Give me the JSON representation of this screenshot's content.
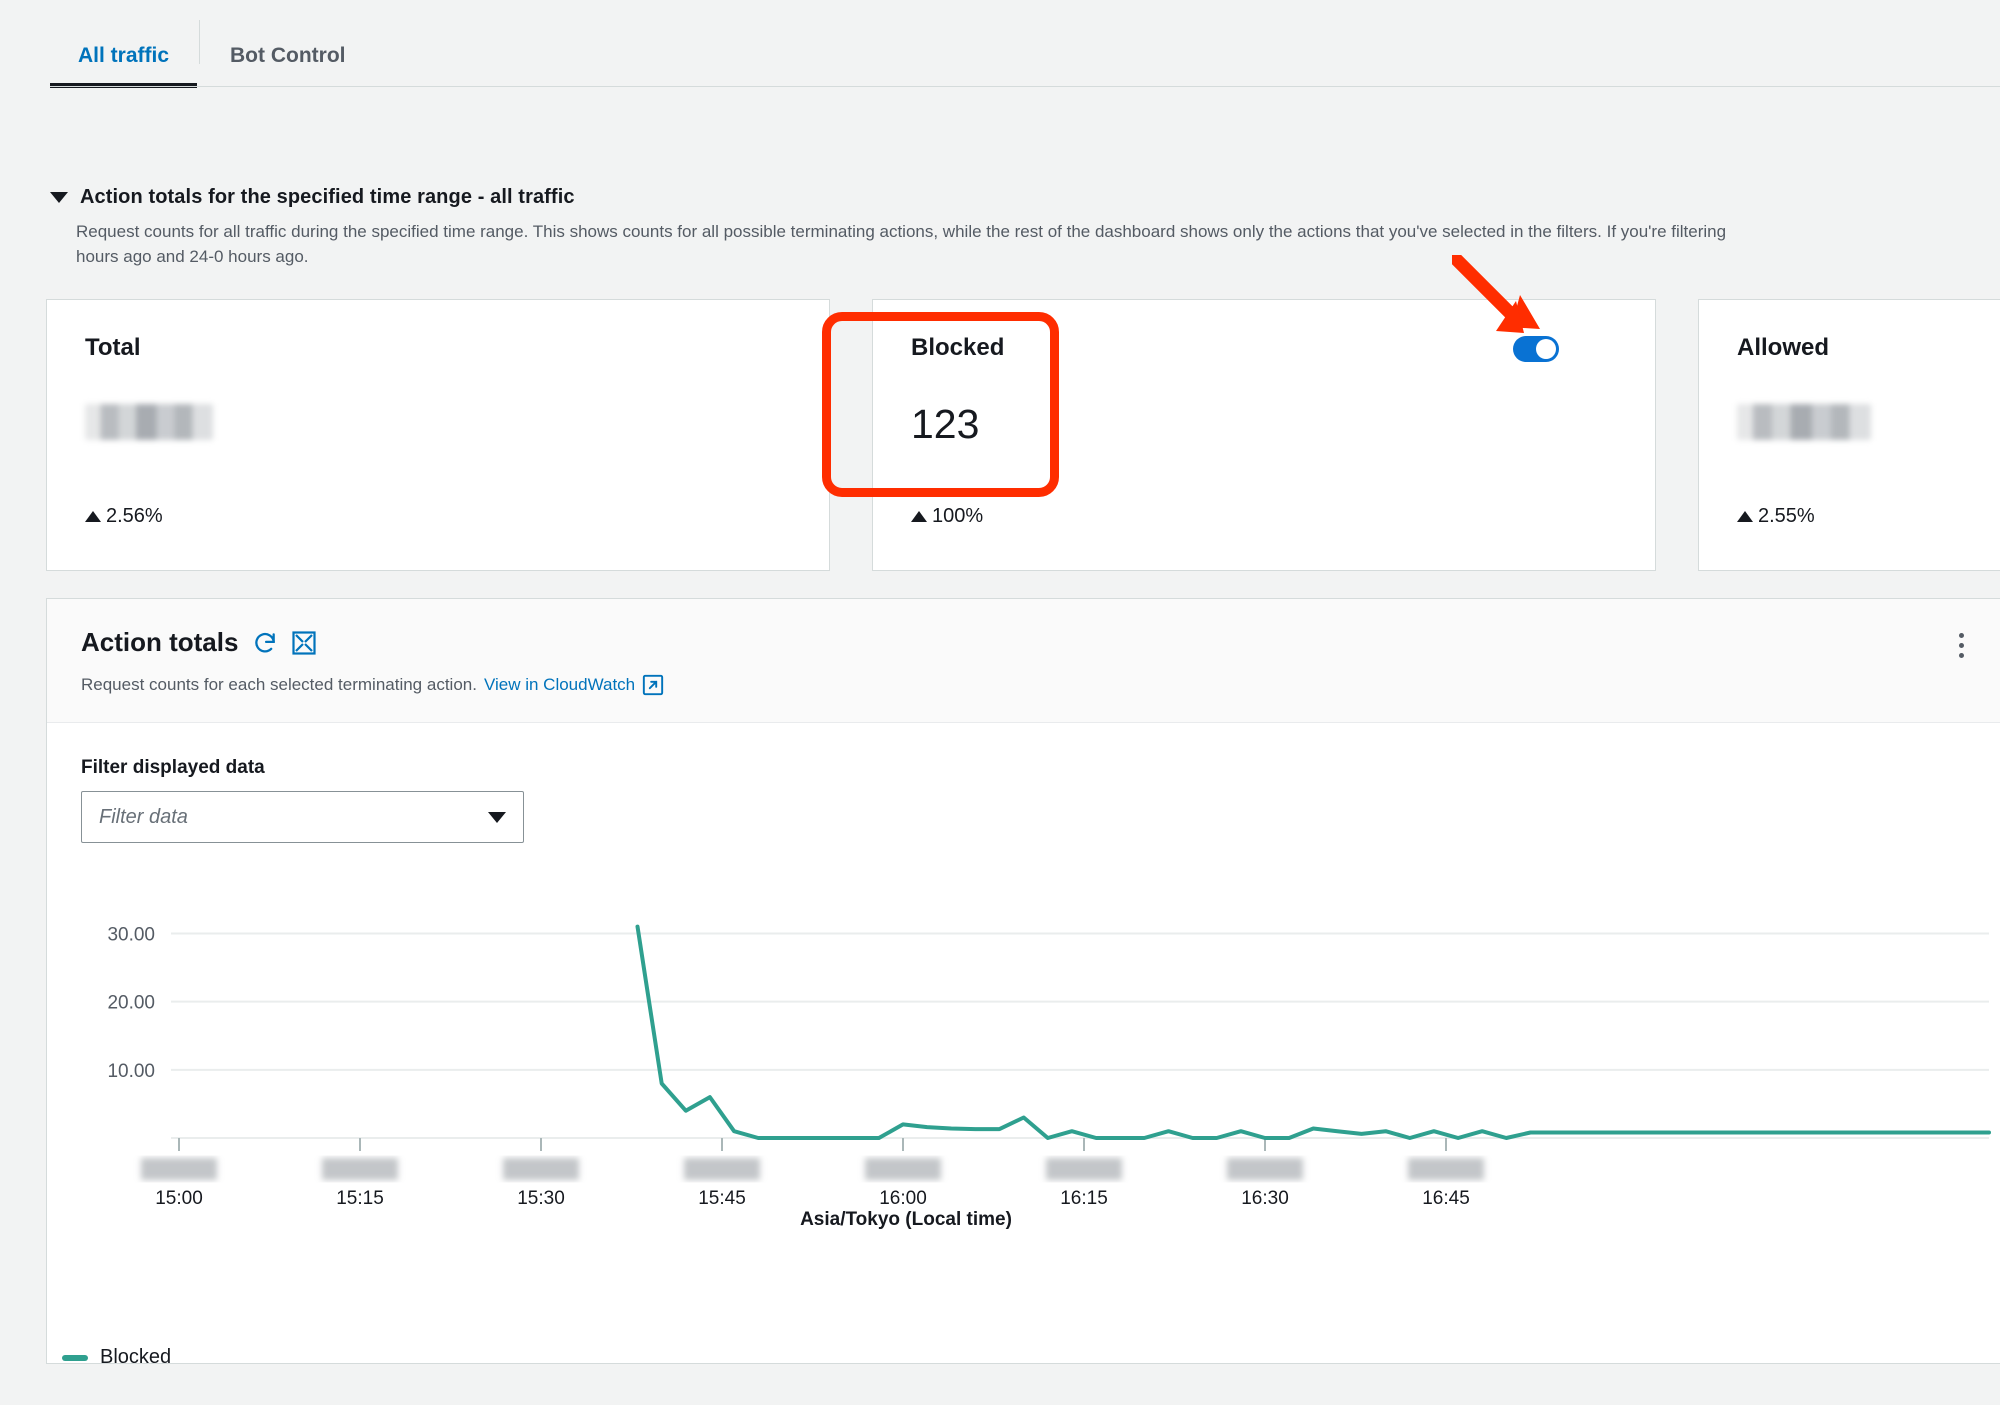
{
  "tabs": [
    {
      "label": "All traffic",
      "active": true
    },
    {
      "label": "Bot Control",
      "active": false
    }
  ],
  "section": {
    "title": "Action totals for the specified time range - all traffic",
    "description": "Request counts for all traffic during the specified time range. This shows counts for all possible terminating actions, while the rest of the dashboard shows only the actions that you've selected in the filters. If you're filtering\nhours ago and 24-0 hours ago."
  },
  "cards": [
    {
      "title": "Total",
      "value": "",
      "value_redacted": true,
      "delta": "2.56%",
      "delta_direction": "up"
    },
    {
      "title": "Blocked",
      "value": "123",
      "value_redacted": false,
      "delta": "100%",
      "delta_direction": "up",
      "highlighted": true,
      "toggle_on": true
    },
    {
      "title": "Allowed",
      "value": "",
      "value_redacted": true,
      "delta": "2.55%",
      "delta_direction": "up"
    }
  ],
  "panel": {
    "title": "Action totals",
    "refresh_icon": "refresh-icon",
    "expand_icon": "expand-icon",
    "kebab_icon": "more-options-icon",
    "subtitle": "Request counts for each selected terminating action.",
    "link_label": "View in CloudWatch",
    "external_icon": "external-link-icon",
    "filter_label": "Filter displayed data",
    "filter_placeholder": "Filter data",
    "filter_value": ""
  },
  "colors": {
    "accent_link": "#0073bb",
    "series_blocked": "#2fa08f",
    "annotation_red": "#ff2d00",
    "toggle_on": "#0972d3"
  },
  "chart_data": {
    "type": "line",
    "title": "Action totals",
    "xlabel": "Asia/Tokyo (Local time)",
    "ylabel": "",
    "ylim": [
      0,
      33
    ],
    "yticks": [
      "10.00",
      "20.00",
      "30.00"
    ],
    "ytick_values": [
      10,
      20,
      30
    ],
    "xticks": [
      "15:00",
      "15:15",
      "15:30",
      "15:45",
      "16:00",
      "16:15",
      "16:30",
      "16:45"
    ],
    "xtick_dates_redacted": true,
    "grid": true,
    "legend": [
      "Blocked"
    ],
    "legend_position": "bottom-left",
    "series": [
      {
        "name": "Blocked",
        "color": "#2fa08f",
        "x": [
          "15:38",
          "15:40",
          "15:42",
          "15:44",
          "15:46",
          "15:48",
          "15:50",
          "15:52",
          "15:54",
          "15:56",
          "15:58",
          "16:00",
          "16:02",
          "16:04",
          "16:06",
          "16:08",
          "16:10",
          "16:12",
          "16:14",
          "16:16",
          "16:18",
          "16:20",
          "16:22",
          "16:24",
          "16:26",
          "16:28",
          "16:30",
          "16:32",
          "16:34",
          "16:36",
          "16:38",
          "16:40",
          "16:42",
          "16:44",
          "16:46",
          "16:48",
          "16:50",
          "16:52"
        ],
        "values": [
          31,
          8,
          4,
          6,
          1,
          0,
          0,
          0,
          0,
          0,
          0,
          2,
          1.6,
          1.4,
          1.3,
          1.3,
          3,
          0,
          1,
          0,
          0,
          0,
          1,
          0,
          0,
          1,
          0,
          0,
          1.4,
          1,
          0.6,
          1,
          0,
          1,
          0,
          1,
          0,
          0.8
        ]
      }
    ]
  }
}
